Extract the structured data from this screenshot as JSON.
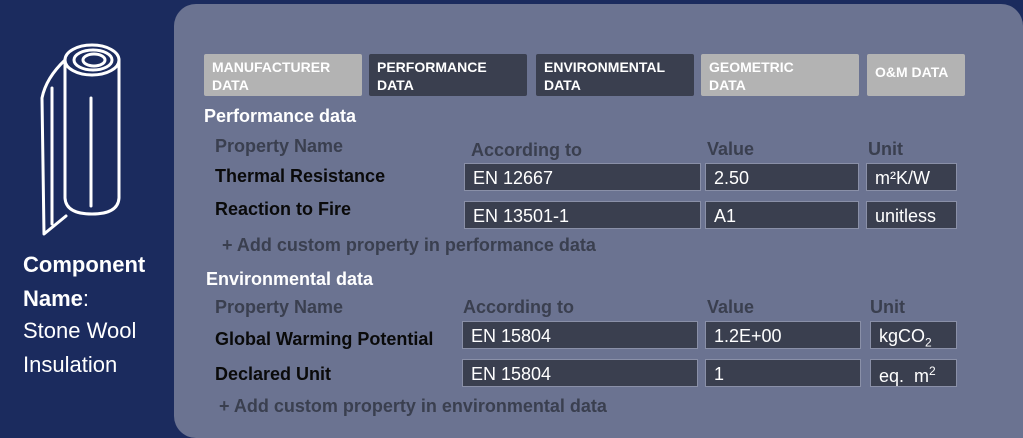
{
  "sidebar": {
    "component_label": "Component Name",
    "component_colon": ":",
    "component_value": "Stone Wool Insulation"
  },
  "tabs": [
    {
      "line1": "MANUFACTURER",
      "line2": "DATA"
    },
    {
      "line1": "PERFORMANCE",
      "line2": "DATA"
    },
    {
      "line1": "ENVIRONMENTAL",
      "line2": "DATA"
    },
    {
      "line1": "GEOMETRIC",
      "line2": "DATA"
    },
    {
      "line1": "O&M DATA",
      "line2": ""
    }
  ],
  "performance": {
    "title": "Performance data",
    "headers": {
      "property": "Property Name",
      "according": "According to",
      "value": "Value",
      "unit": "Unit"
    },
    "rows": [
      {
        "name": "Thermal Resistance",
        "according": "EN 12667",
        "value": "2.50",
        "unit": "m²K/W"
      },
      {
        "name": "Reaction to Fire",
        "according": "EN 13501-1",
        "value": "A1",
        "unit": "unitless"
      }
    ],
    "add_label": "+ Add custom property in performance data"
  },
  "environmental": {
    "title": "Environmental data",
    "headers": {
      "property": "Property Name",
      "according": "According to",
      "value": "Value",
      "unit": "Unit"
    },
    "rows": [
      {
        "name": "Global Warming Potential",
        "according": "EN 15804",
        "value": "1.2E+00",
        "unit_main": "kgCO",
        "unit_sub": "2"
      },
      {
        "name": "Declared Unit",
        "according": "EN 15804",
        "value": "1",
        "unit_main": "eq.  m",
        "unit_sup": "2"
      }
    ],
    "add_label": "+ Add custom property in environmental data"
  }
}
